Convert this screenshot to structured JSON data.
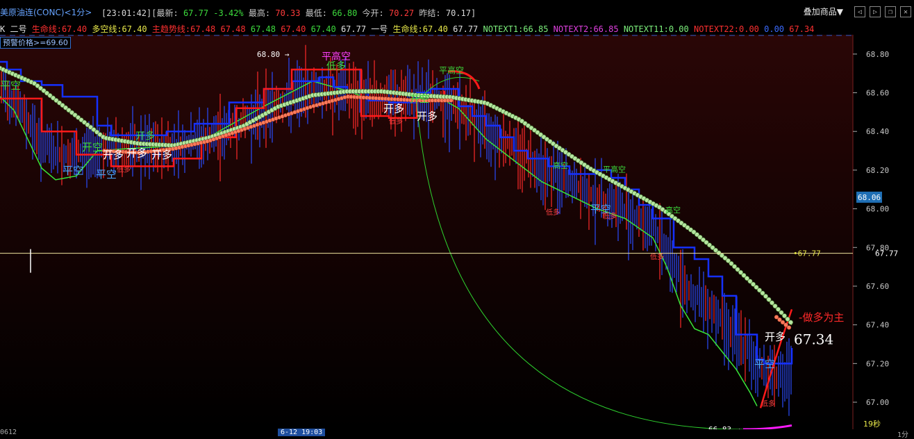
{
  "header": {
    "title": "美原油连(CONC)<1分>",
    "time": "[23:01:42]",
    "latest_label": "[最新:",
    "latest": "67.77",
    "change": "-3.42%",
    "high_label": "最高:",
    "high": "70.33",
    "low_label": "最低:",
    "low": "66.80",
    "open_label": "今开:",
    "open": "70.27",
    "settle_label": "昨结:",
    "settle": "70.17]",
    "overlay_button": "叠加商品▼"
  },
  "legend": {
    "k": "K",
    "erhao": "二号",
    "life_line": "生命线:67.40",
    "bull_bear": "多空线:67.40",
    "main_trend": "主趋势线:67.48",
    "v1": "67.48",
    "v2": "67.48",
    "v3": "67.40",
    "v4": "67.40",
    "v5": "67.77",
    "yihao": "一号",
    "life_line2": "生命线:67.40",
    "v6": "67.77",
    "notext1": "NOTEXT1:66.85",
    "notext2": "NOTEXT2:66.85",
    "notext11": "NOTEXT11:0.00",
    "notext22": "NOTEXT22:0.00",
    "v7": "0.00",
    "v8": "67.34"
  },
  "alert": "预警价格>=69.60",
  "timebar": {
    "left": "0612",
    "cursor": "6-12 19:03",
    "right": "1分"
  },
  "countdown": "19秒",
  "colors": {
    "candle_up": "#ff2a2a",
    "candle_down": "#2a4cff",
    "green_line": "#39e639",
    "blue_step": "#1530ff",
    "red_step": "#ff1a1a",
    "yellow_line": "#e6e63c",
    "bead_green": "#b5e6a0",
    "bead_red": "#ff7a5a"
  },
  "chart_data": {
    "type": "line",
    "ylim": [
      66.86,
      68.9
    ],
    "y_ticks": [
      "68.80",
      "68.60",
      "68.40",
      "68.20",
      "68.00",
      "67.80",
      "67.60",
      "67.40",
      "67.20",
      "67.00"
    ],
    "current_price_label": "68.06",
    "crosshair_price": "67.77",
    "crosshair_label": "67.77",
    "max_marker": "68.80",
    "min_marker": "66.83",
    "last_value": "67.34",
    "note": "-做多为主",
    "series": [
      {
        "name": "生命线",
        "color": "#e6e63c",
        "x": [
          0,
          50,
          100,
          150,
          200,
          250,
          300,
          350,
          400,
          450,
          500,
          550,
          600,
          650,
          700,
          750,
          800,
          850,
          900,
          950,
          1000,
          1050,
          1100,
          1140
        ],
        "values": [
          68.72,
          68.64,
          68.5,
          68.36,
          68.33,
          68.32,
          68.36,
          68.42,
          68.52,
          68.58,
          68.6,
          68.6,
          68.58,
          68.57,
          68.54,
          68.45,
          68.32,
          68.2,
          68.1,
          68.0,
          67.87,
          67.72,
          67.55,
          67.4
        ]
      },
      {
        "name": "多空线",
        "color": "#ff7a5a",
        "x": [
          150,
          200,
          250,
          300,
          350,
          400,
          450,
          500,
          550,
          600,
          650
        ],
        "values": [
          68.3,
          68.29,
          68.31,
          68.35,
          68.41,
          68.47,
          68.53,
          68.58,
          68.57,
          68.56,
          68.56
        ]
      },
      {
        "name": "主趋势线",
        "color": "#1530ff",
        "x": [
          0,
          10,
          30,
          60,
          90,
          140,
          160,
          200,
          240,
          280,
          330,
          380,
          420,
          460,
          480,
          500,
          530,
          560,
          600,
          620,
          660,
          680,
          700,
          720,
          740,
          760,
          790,
          820,
          860,
          880,
          900,
          920,
          940,
          970,
          1000,
          1020,
          1040,
          1060,
          1090,
          1100,
          1140
        ],
        "values": [
          68.76,
          68.72,
          68.66,
          68.64,
          68.58,
          68.43,
          68.38,
          68.38,
          68.4,
          68.44,
          68.55,
          68.62,
          68.66,
          68.68,
          68.63,
          68.6,
          68.56,
          68.55,
          68.6,
          68.62,
          68.53,
          68.48,
          68.43,
          68.37,
          68.3,
          68.26,
          68.22,
          68.18,
          68.2,
          68.16,
          68.1,
          68.02,
          67.95,
          67.8,
          67.74,
          67.65,
          67.55,
          67.35,
          67.22,
          67.2,
          67.28
        ]
      },
      {
        "name": "生命线2",
        "color": "#ff1a1a",
        "x": [
          0,
          60,
          110,
          160,
          220,
          250,
          290,
          340,
          380,
          420,
          460,
          520,
          560,
          600,
          640
        ],
        "values": [
          68.57,
          68.4,
          68.28,
          68.22,
          68.22,
          68.26,
          68.37,
          68.52,
          68.62,
          68.72,
          68.72,
          68.48,
          68.47,
          68.56,
          68.61
        ]
      },
      {
        "name": "NOTEXT1",
        "color": "#39e639",
        "x": [
          0,
          20,
          40,
          60,
          80,
          110,
          140,
          180,
          230,
          300,
          380,
          450,
          500,
          530,
          560,
          600,
          630,
          660,
          700,
          740,
          780,
          820,
          860,
          900,
          940,
          960,
          980,
          1000,
          1020,
          1040,
          1060,
          1080,
          1090
        ],
        "values": [
          68.58,
          68.51,
          68.36,
          68.21,
          68.15,
          68.17,
          68.3,
          68.31,
          68.32,
          68.37,
          68.53,
          68.66,
          68.61,
          68.57,
          68.56,
          68.57,
          68.58,
          68.52,
          68.36,
          68.25,
          68.14,
          68.07,
          68.0,
          67.95,
          67.85,
          67.7,
          67.5,
          67.38,
          67.35,
          67.26,
          67.17,
          67.05,
          66.98
        ]
      }
    ],
    "annotations": [
      "平空",
      "开空",
      "开多",
      "开多",
      "开多",
      "平空",
      "平空",
      "低多",
      "平高空",
      "开空",
      "开多",
      "开多",
      "低多",
      "平高空",
      "开多",
      "低多",
      "高空",
      "平高空",
      "平空",
      "低多",
      "低多",
      "高空",
      "低多",
      "平空",
      "开多",
      "低多"
    ]
  }
}
